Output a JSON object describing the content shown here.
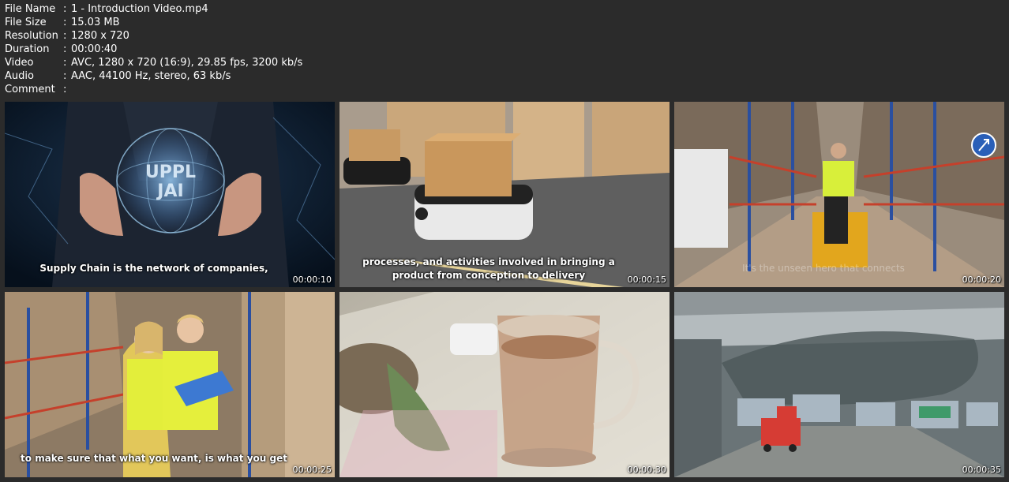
{
  "info": [
    {
      "key": "File Name",
      "value": "1 - Introduction Video.mp4"
    },
    {
      "key": "File Size",
      "value": "15.03 MB"
    },
    {
      "key": "Resolution",
      "value": "1280 x 720"
    },
    {
      "key": "Duration",
      "value": "00:00:40"
    },
    {
      "key": "Video",
      "value": "AVC, 1280 x 720 (16:9), 29.85 fps, 3200 kb/s"
    },
    {
      "key": "Audio",
      "value": "AAC, 44100 Hz, stereo, 63 kb/s"
    },
    {
      "key": "Comment",
      "value": ""
    }
  ],
  "separator": ":",
  "thumbnails": [
    {
      "time": "00:00:10",
      "subtitle": "Supply Chain is the network of companies,",
      "overlay_text": "UPPL\nJAI"
    },
    {
      "time": "00:00:15",
      "subtitle": "processes, and activities involved in bringing a product from conception to delivery"
    },
    {
      "time": "00:00:20",
      "subtitle": "It's the unseen hero that connects"
    },
    {
      "time": "00:00:25",
      "subtitle": "to make sure that what you want, is what you get"
    },
    {
      "time": "00:00:30",
      "subtitle": ""
    },
    {
      "time": "00:00:35",
      "subtitle": ""
    }
  ]
}
